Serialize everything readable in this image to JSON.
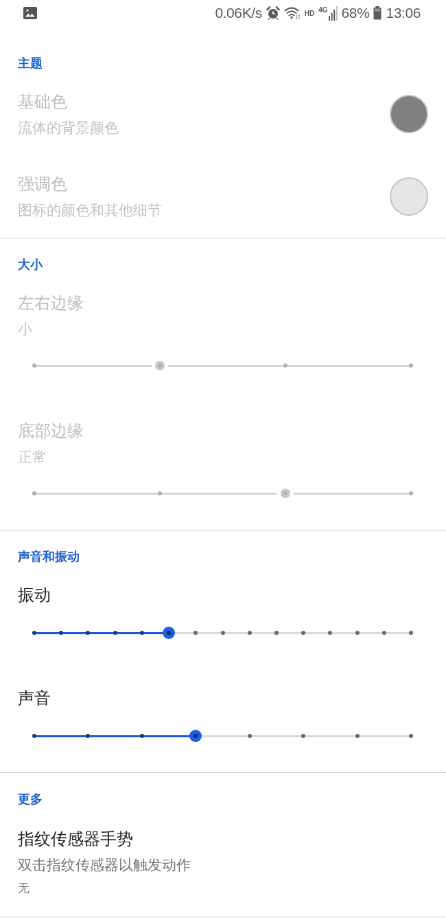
{
  "status_bar": {
    "speed": "0.06K/s",
    "hd_label": "HD",
    "network_type": "4G",
    "battery": "68%",
    "time": "13:06"
  },
  "sections": [
    {
      "title": "主题",
      "items": [
        {
          "kind": "color",
          "title": "基础色",
          "subtitle": "流体的背景颜色",
          "disabled": true,
          "color": "#808080"
        },
        {
          "kind": "color",
          "title": "强调色",
          "subtitle": "图标的颜色和其他细节",
          "disabled": true,
          "color": "#e6e6e6"
        }
      ]
    },
    {
      "title": "大小",
      "items": [
        {
          "kind": "slider",
          "title": "左右边缘",
          "subtitle": "小",
          "disabled": true,
          "level": 0.3333,
          "stops": [
            {
              "selected": false
            },
            {
              "selected": true
            },
            {
              "selected": false
            },
            {
              "selected": false
            }
          ]
        },
        {
          "kind": "slider",
          "title": "底部边缘",
          "subtitle": "正常",
          "disabled": true,
          "level": 0.6667,
          "stops": [
            {
              "selected": false
            },
            {
              "selected": false
            },
            {
              "selected": true
            },
            {
              "selected": false
            }
          ]
        }
      ]
    },
    {
      "title": "声音和振动",
      "items": [
        {
          "kind": "slider",
          "title": "振动",
          "disabled": false,
          "level": 0.3571,
          "stops": [
            {
              "selected": false
            },
            {
              "selected": false
            },
            {
              "selected": false
            },
            {
              "selected": false
            },
            {
              "selected": false
            },
            {
              "selected": true
            },
            {
              "selected": false
            },
            {
              "selected": false
            },
            {
              "selected": false
            },
            {
              "selected": false
            },
            {
              "selected": false
            },
            {
              "selected": false
            },
            {
              "selected": false
            },
            {
              "selected": false
            },
            {
              "selected": false
            }
          ]
        },
        {
          "kind": "slider",
          "title": "声音",
          "disabled": false,
          "level": 0.4286,
          "stops": [
            {
              "selected": false
            },
            {
              "selected": false
            },
            {
              "selected": false
            },
            {
              "selected": true
            },
            {
              "selected": false
            },
            {
              "selected": false
            },
            {
              "selected": false
            },
            {
              "selected": false
            }
          ]
        }
      ]
    },
    {
      "title": "更多",
      "items": [
        {
          "kind": "text",
          "title": "指纹传感器手势",
          "subtitle": "双击指纹传感器以触发动作",
          "value": "无",
          "disabled": false
        }
      ]
    }
  ]
}
